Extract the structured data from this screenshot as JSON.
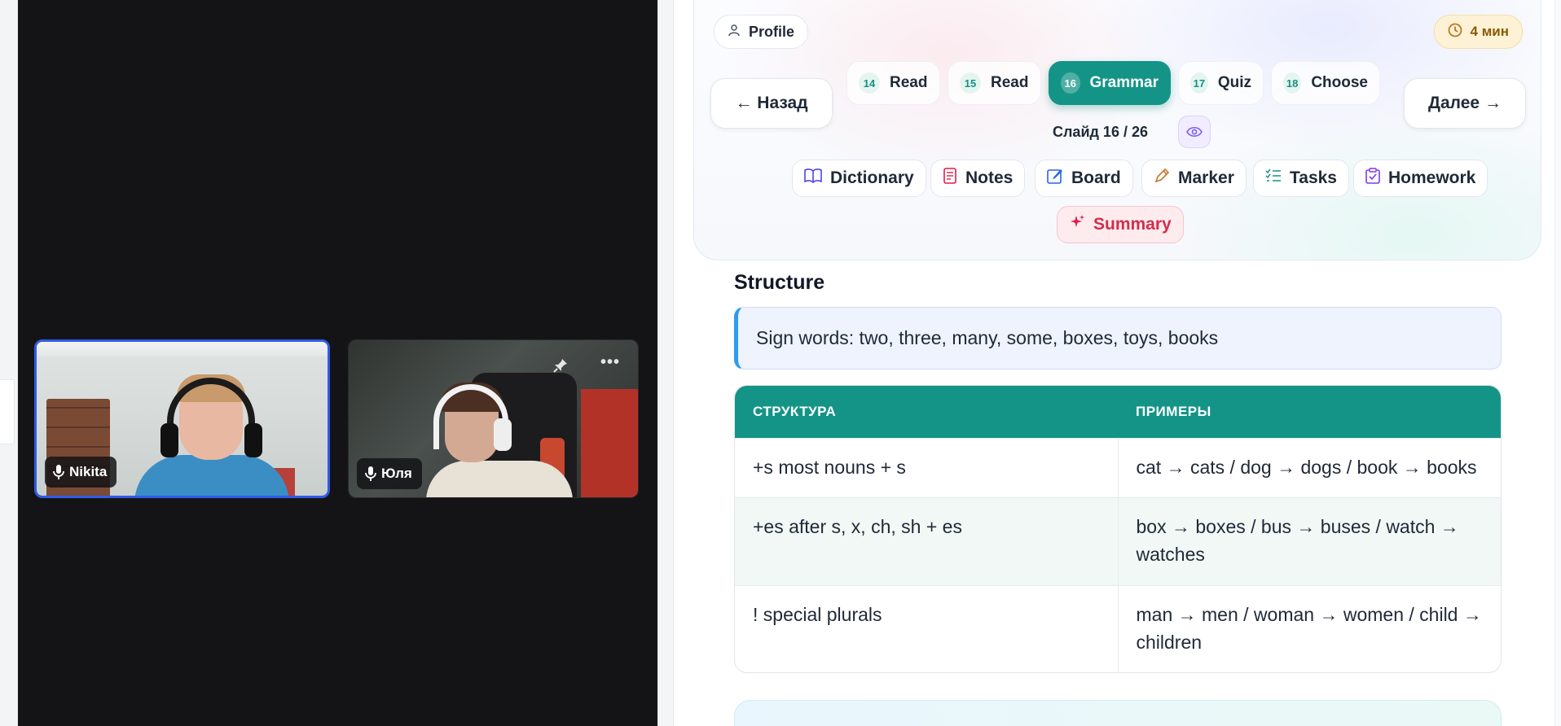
{
  "video": {
    "participants": [
      {
        "name": "Nikita",
        "active": true
      },
      {
        "name": "Юля",
        "active": false
      }
    ],
    "icons": [
      "mic-icon",
      "pin-icon",
      "more-icon"
    ]
  },
  "header": {
    "profile_label": "Profile",
    "timer": "4 мин",
    "back_label": "← Назад",
    "next_label": "Далее →",
    "slides": [
      {
        "num": "14",
        "label": "Read"
      },
      {
        "num": "15",
        "label": "Read"
      },
      {
        "num": "16",
        "label": "Grammar",
        "current": true
      },
      {
        "num": "17",
        "label": "Quiz"
      },
      {
        "num": "18",
        "label": "Choose"
      }
    ],
    "slide_counter": "Слайд 16 / 26"
  },
  "tools": [
    {
      "label": "Dictionary",
      "icon": "book-icon"
    },
    {
      "label": "Notes",
      "icon": "notes-icon"
    },
    {
      "label": "Board",
      "icon": "board-icon"
    },
    {
      "label": "Marker",
      "icon": "marker-icon"
    },
    {
      "label": "Tasks",
      "icon": "tasks-icon"
    },
    {
      "label": "Homework",
      "icon": "clipboard-icon"
    },
    {
      "label": "Summary",
      "icon": "sparkle-icon"
    }
  ],
  "content": {
    "section_title": "Structure",
    "sign_words": "Sign words: two, three, many, some, boxes, toys, books",
    "table": {
      "headers": [
        "СТРУКТУРА",
        "ПРИМЕРЫ"
      ],
      "rows": [
        [
          "+s most nouns + s",
          "cat → cats / dog → dogs / book → books"
        ],
        [
          "+es after s, x, ch, sh + es",
          "box → boxes / bus → buses / watch → watches"
        ],
        [
          "! special plurals",
          "man → men / woman → women / child → children"
        ]
      ]
    }
  },
  "colors": {
    "accent": "#149487",
    "active_tile_border": "#2f5bea",
    "summary": "#d12f4a",
    "timer_bg": "#fdf2d6"
  }
}
